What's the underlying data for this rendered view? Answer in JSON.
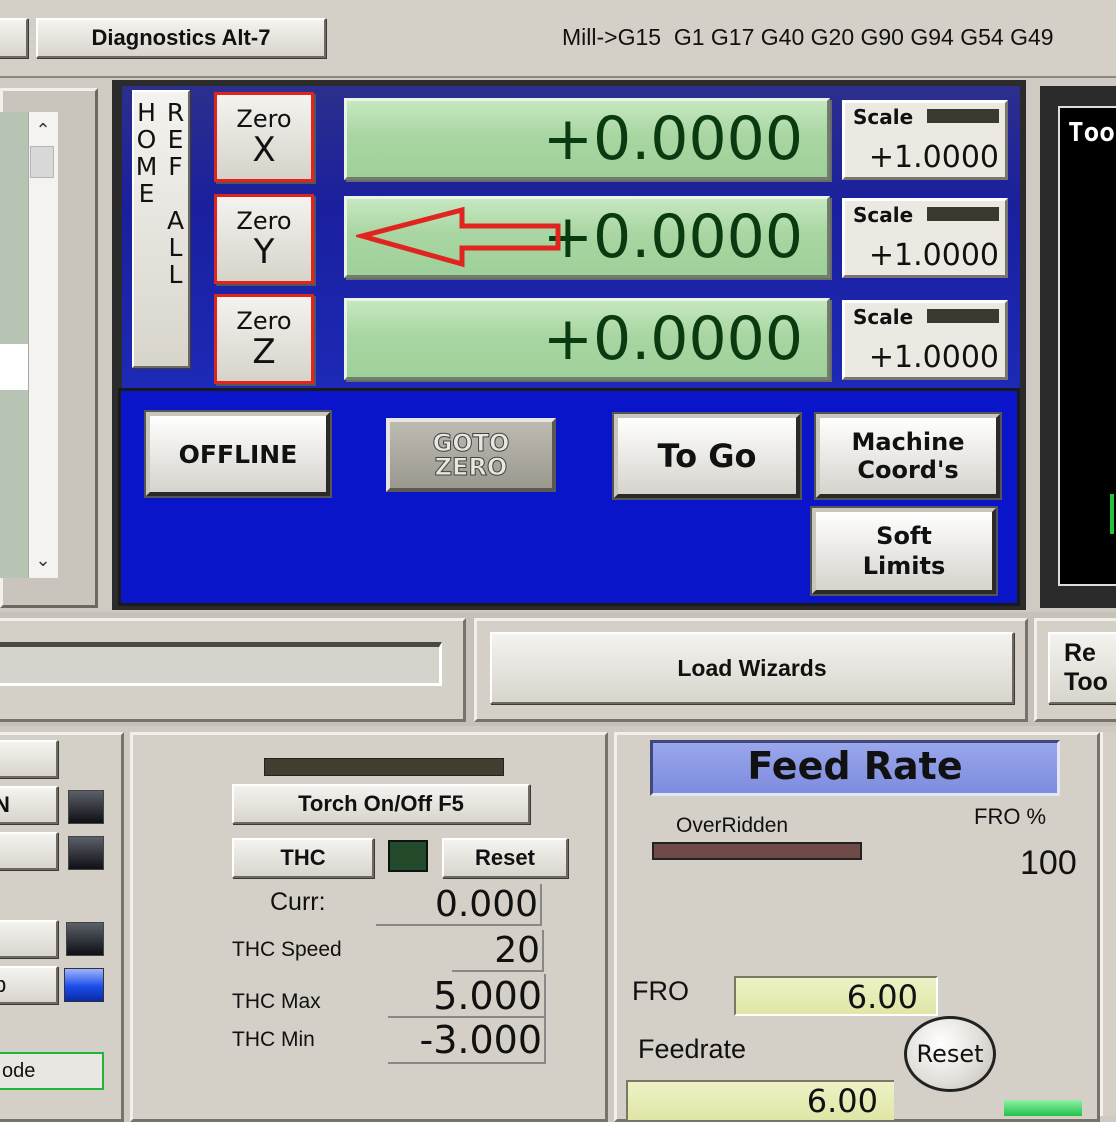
{
  "toolbar": {
    "diagnostics_label": "Diagnostics Alt-7",
    "gcode_status": "Mill->G15  G1 G17 G40 G20 G90 G94 G54 G49"
  },
  "dro": {
    "ref_all_home": "REF ALL HOME",
    "zero_word": "Zero",
    "axes": [
      {
        "axis": "X",
        "value": "+0.0000",
        "scale_label": "Scale",
        "scale_value": "+1.0000"
      },
      {
        "axis": "Y",
        "value": "+0.0000",
        "scale_label": "Scale",
        "scale_value": "+1.0000"
      },
      {
        "axis": "Z",
        "value": "+0.0000",
        "scale_label": "Scale",
        "scale_value": "+1.0000"
      }
    ],
    "offline_label": "OFFLINE",
    "goto_zero_label": "GOTO ZERO",
    "to_go_label": "To Go",
    "machine_coords_label": "Machine Coord's",
    "soft_limits_label": "Soft Limits"
  },
  "toolpath": {
    "label": "Too"
  },
  "wizards": {
    "load_label": "Load Wizards",
    "regen_label_1": "Re",
    "regen_label_2": "Too"
  },
  "left_panel": {
    "n_label": "N",
    "p_label": "p",
    "mode_label": "ode"
  },
  "thc": {
    "torch_label": "Torch On/Off F5",
    "thc_label": "THC",
    "reset_label": "Reset",
    "curr_label": "Curr:",
    "curr_value": "0.000",
    "speed_label": "THC Speed",
    "speed_value": "20",
    "max_label": "THC Max",
    "max_value": "5.000",
    "min_label": "THC Min",
    "min_value": "-3.000"
  },
  "feed": {
    "title": "Feed Rate",
    "overridden_label": "OverRidden",
    "fro_pct_label": "FRO %",
    "fro_pct_value": "100",
    "fro_label": "FRO",
    "fro_value": "6.00",
    "feedrate_label": "Feedrate",
    "feedrate_value": "6.00",
    "reset_label": "Reset"
  },
  "colors": {
    "dro_blue": "#0a14c8",
    "annotation_arrow": "#e0241f",
    "dro_green": "#a9d6a2"
  }
}
